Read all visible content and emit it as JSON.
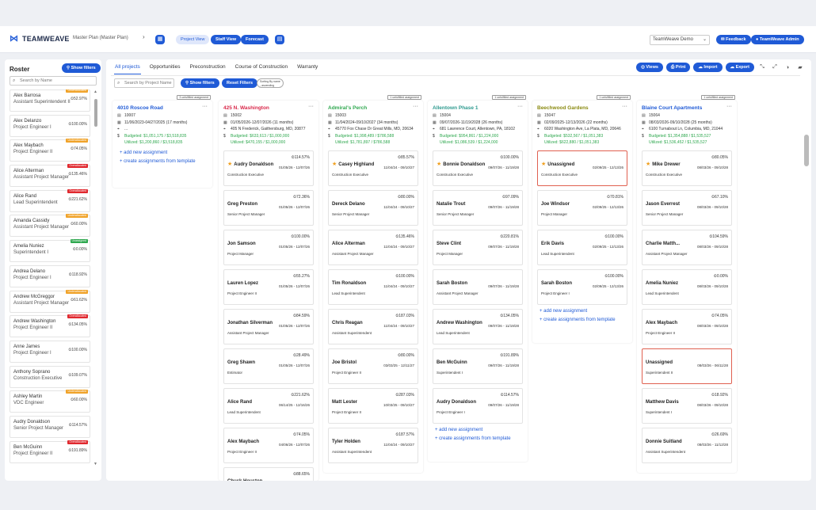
{
  "app": {
    "brand": "TEAMWEAVE",
    "plan": "Master Plan (Master Plan)",
    "project_view": "Project View",
    "staff_view": "Staff View",
    "forecast": "Forecast",
    "workspace": "TeamWeave Demo",
    "feedback": "Feedback",
    "admin": "TeamWeave Admin"
  },
  "roster": {
    "title": "Roster",
    "show_filters": "Show filters",
    "search_placeholder": "Search by Name",
    "people": [
      {
        "name": "Alex Barrosa",
        "role": "Assistant Superintendent II",
        "pct": "52.97%",
        "tag": "Underallocated",
        "tagc": "orange"
      },
      {
        "name": "Alex Delanzo",
        "role": "Project Engineer I",
        "pct": "100.00%",
        "tag": "",
        "tagc": ""
      },
      {
        "name": "Alex Maybach",
        "role": "Project Engineer II",
        "pct": "74.05%",
        "tag": "Underallocated",
        "tagc": "orange"
      },
      {
        "name": "Alice Alterman",
        "role": "Assistant Project Manager",
        "pct": "135.46%",
        "tag": "Overallocated",
        "tagc": "red"
      },
      {
        "name": "Alice Rand",
        "role": "Lead Superintendent",
        "pct": "221.62%",
        "tag": "Overallocated",
        "tagc": "red"
      },
      {
        "name": "Amanda Cassidy",
        "role": "Assistant Project Manager",
        "pct": "60.00%",
        "tag": "Underallocated",
        "tagc": "orange"
      },
      {
        "name": "Amelia Nuniez",
        "role": "Superintendent I",
        "pct": "0.00%",
        "tag": "Unassigned",
        "tagc": "green"
      },
      {
        "name": "Andrea Delano",
        "role": "Project Engineer I",
        "pct": "118.92%",
        "tag": "",
        "tagc": ""
      },
      {
        "name": "Andrew McGreggor",
        "role": "Assistant Project Manager",
        "pct": "61.62%",
        "tag": "Underallocated",
        "tagc": "orange"
      },
      {
        "name": "Andrew Washington",
        "role": "Project Engineer II",
        "pct": "134.05%",
        "tag": "Overallocated",
        "tagc": "red"
      },
      {
        "name": "Anne James",
        "role": "Project Engineer I",
        "pct": "100.00%",
        "tag": "",
        "tagc": ""
      },
      {
        "name": "Anthony Soprano",
        "role": "Construction Executive",
        "pct": "109.07%",
        "tag": "",
        "tagc": ""
      },
      {
        "name": "Ashley Martin",
        "role": "VDC Engineer",
        "pct": "60.00%",
        "tag": "Underallocated",
        "tagc": "orange"
      },
      {
        "name": "Audry Donaldson",
        "role": "Senior Project Manager",
        "pct": "114.57%",
        "tag": "",
        "tagc": ""
      },
      {
        "name": "Ben McGuinn",
        "role": "Project Engineer II",
        "pct": "191.89%",
        "tag": "Overallocated",
        "tagc": "red"
      }
    ]
  },
  "main": {
    "tabs": [
      "All projects",
      "Opportunities",
      "Preconstruction",
      "Course of Construction",
      "Warranty"
    ],
    "views": "Views",
    "print": "Print",
    "import": "Import",
    "export": "Export",
    "search_placeholder": "Search by Project Name",
    "show_filters": "Show filters",
    "reset_filters": "Reset Filters",
    "sort": "Sorting By name - ascending",
    "add": "+ add new assignment",
    "create": "+ create assignments from template"
  },
  "columns": [
    {
      "title": "4010 Roscoe Road",
      "color": "c-blue",
      "unf": "3 unfulfilled assignment",
      "id": "10007",
      "dates": "11/06/2023-04/27/2025 (17 months)",
      "addr": "...",
      "budget": "Budgeted: $1,051,175 / $3,518,835",
      "util": "Utilized: $1,200,860 / $3,518,835",
      "cards": []
    },
    {
      "title": "425 N. Washington",
      "color": "c-red",
      "unf": "",
      "id": "15002",
      "dates": "01/05/2026-12/07/2026 (11 months)",
      "addr": "405 N Frederick, Gaithersburg, MD, 20877",
      "budget": "Budgeted: $633,613 / $1,000,000",
      "util": "Utilized: $470,155 / $1,000,000",
      "cards": [
        {
          "n": "Audry Donaldson",
          "p": "114.57%",
          "r": "Construction Executive",
          "d": "01/05/26 - 12/07/26",
          "s": true
        },
        {
          "n": "Greg Preston",
          "p": "72.36%",
          "r": "Senior Project Manager",
          "d": "01/05/26 - 12/07/26"
        },
        {
          "n": "Jon Samson",
          "p": "100.00%",
          "r": "Project Manager",
          "d": "01/05/26 - 12/07/26"
        },
        {
          "n": "Lauren Lopez",
          "p": "55.27%",
          "r": "Project Engineer II",
          "d": "01/05/26 - 12/07/26"
        },
        {
          "n": "Jonathan Silverman",
          "p": "84.59%",
          "r": "Assistant Project Manager",
          "d": "01/05/26 - 12/07/26"
        },
        {
          "n": "Greg Shawn",
          "p": "28.49%",
          "r": "Estimator",
          "d": "01/05/26 - 12/07/26"
        },
        {
          "n": "Alice Rand",
          "p": "221.62%",
          "r": "Lead Superintendent",
          "d": "06/14/25 - 12/16/26"
        },
        {
          "n": "Alex Maybach",
          "p": "74.05%",
          "r": "Project Engineer II",
          "d": "04/06/26 - 12/07/26"
        },
        {
          "n": "Chuck Houston",
          "p": "88.65%",
          "r": "",
          "d": ""
        }
      ]
    },
    {
      "title": "Admiral's Perch",
      "color": "c-green",
      "unf": "1 unfulfilled assignment",
      "id": "15003",
      "dates": "11/04/2024-09/10/2027 (34 months)",
      "addr": "45770 Fox Chase Dr Great Mills, MD, 20634",
      "budget": "Budgeted: $1,998,489 / $786,588",
      "util": "Utilized: $1,781,897 / $786,588",
      "cards": [
        {
          "n": "Casey Highland",
          "p": "85.57%",
          "r": "Construction Executive",
          "d": "11/04/24 - 09/10/27",
          "s": true
        },
        {
          "n": "Dereck Delano",
          "p": "80.00%",
          "r": "Senior Project Manager",
          "d": "11/04/24 - 09/10/27"
        },
        {
          "n": "Alice Alterman",
          "p": "135.46%",
          "r": "Assistant Project Manager",
          "d": "11/04/24 - 09/10/27"
        },
        {
          "n": "Tim Ronaldson",
          "p": "100.00%",
          "r": "Lead Superintendent",
          "d": "11/04/24 - 09/10/27"
        },
        {
          "n": "Chris Reagan",
          "p": "187.03%",
          "r": "Assistant Superintendent",
          "d": "11/04/24 - 09/10/27"
        },
        {
          "n": "Joe Bristol",
          "p": "80.00%",
          "r": "Project Engineer II",
          "d": "03/03/25 - 12/11/27"
        },
        {
          "n": "Matt Lester",
          "p": "287.03%",
          "r": "Project Engineer II",
          "d": "10/03/25 - 09/10/27"
        },
        {
          "n": "Tyler Holden",
          "p": "187.57%",
          "r": "Assistant Superintendent",
          "d": "11/04/24 - 09/10/27"
        }
      ]
    },
    {
      "title": "Allentown Phase 1",
      "color": "c-teal",
      "unf": "1 unfulfilled assignment",
      "id": "15004",
      "dates": "09/07/2026-11/19/2028 (26 months)",
      "addr": "681 Lawrence Court, Allentown, PA, 18102",
      "budget": "Budgeted: $954,861 / $1,224,000",
      "util": "Utilized: $1,086,539 / $1,224,000",
      "cards": [
        {
          "n": "Bonnie Donaldson",
          "p": "100.00%",
          "r": "Construction Executive",
          "d": "09/07/26 - 11/19/28",
          "s": true
        },
        {
          "n": "Natalie Trout",
          "p": "97.09%",
          "r": "Senior Project Manager",
          "d": "09/07/26 - 11/19/28"
        },
        {
          "n": "Steve Clint",
          "p": "220.81%",
          "r": "Project Manager",
          "d": "09/07/26 - 11/19/28"
        },
        {
          "n": "Sarah Boston",
          "p": "",
          "r": "Assistant Project Manager",
          "d": "09/07/26 - 11/19/28"
        },
        {
          "n": "Andrew Washington",
          "p": "134.05%",
          "r": "Lead Superintendent",
          "d": "09/07/26 - 11/19/28"
        },
        {
          "n": "Ben McGuinn",
          "p": "191.89%",
          "r": "Superintendent I",
          "d": "09/07/26 - 11/19/28"
        },
        {
          "n": "Audry Donaldson",
          "p": "114.57%",
          "r": "Project Engineer I",
          "d": "09/07/26 - 11/19/28"
        }
      ]
    },
    {
      "title": "Beechwood Gardens",
      "color": "c-olive",
      "unf": "1 unfulfilled assignment",
      "id": "15047",
      "dates": "02/09/2025-12/13/2026 (22 months)",
      "addr": "6020 Washington Ave, La Plata, MD, 20646",
      "budget": "Budgeted: $532,567 / $1,051,383",
      "util": "Utilized: $622,880 / $1,051,383",
      "cards": [
        {
          "n": "Unassigned",
          "p": "",
          "r": "Construction Executive",
          "d": "02/09/25 - 12/13/26",
          "s": true,
          "u": true
        },
        {
          "n": "Joe Windsor",
          "p": "70.81%",
          "r": "Project Manager",
          "d": "02/09/25 - 12/13/26"
        },
        {
          "n": "Erik Davis",
          "p": "100.00%",
          "r": "Lead Superintendent",
          "d": "02/09/25 - 12/13/26"
        },
        {
          "n": "Sarah Boston",
          "p": "100.00%",
          "r": "Project Engineer I",
          "d": "02/09/25 - 12/13/26"
        }
      ]
    },
    {
      "title": "Blaine Court Apartments",
      "color": "c-blue",
      "unf": "1 unfulfilled assignment",
      "id": "15064",
      "dates": "08/03/2026-09/10/2028 (25 months)",
      "addr": "6100 Turnabout Ln, Columbia, MD, 21044",
      "budget": "Budgeted: $1,354,888 / $1,535,527",
      "util": "Utilized: $1,536,452 / $1,535,527",
      "cards": [
        {
          "n": "Mike Drewer",
          "p": "80.05%",
          "r": "Construction Executive",
          "d": "08/03/26 - 09/10/28",
          "s": true
        },
        {
          "n": "Jason Everrest",
          "p": "67.10%",
          "r": "Senior Project Manager",
          "d": "08/03/26 - 09/10/28"
        },
        {
          "n": "Charlie Matth...",
          "p": "104.59%",
          "r": "Assistant Project Manager",
          "d": "08/03/26 - 09/10/28"
        },
        {
          "n": "Amelia Nuniez",
          "p": "0.00%",
          "r": "Lead Superintendent",
          "d": "08/03/26 - 09/10/28"
        },
        {
          "n": "Alex Maybach",
          "p": "74.05%",
          "r": "Project Engineer II",
          "d": "08/03/26 - 09/10/28"
        },
        {
          "n": "Unassigned",
          "p": "",
          "r": "Superintendent II",
          "d": "08/03/26 - 06/11/28",
          "u": true
        },
        {
          "n": "Matthew Davis",
          "p": "18.92%",
          "r": "Superintendent I",
          "d": "08/03/26 - 09/10/28"
        },
        {
          "n": "Donnie Suitland",
          "p": "26.69%",
          "r": "Assistant Superintendent",
          "d": "08/03/26 - 11/12/28"
        }
      ]
    }
  ]
}
